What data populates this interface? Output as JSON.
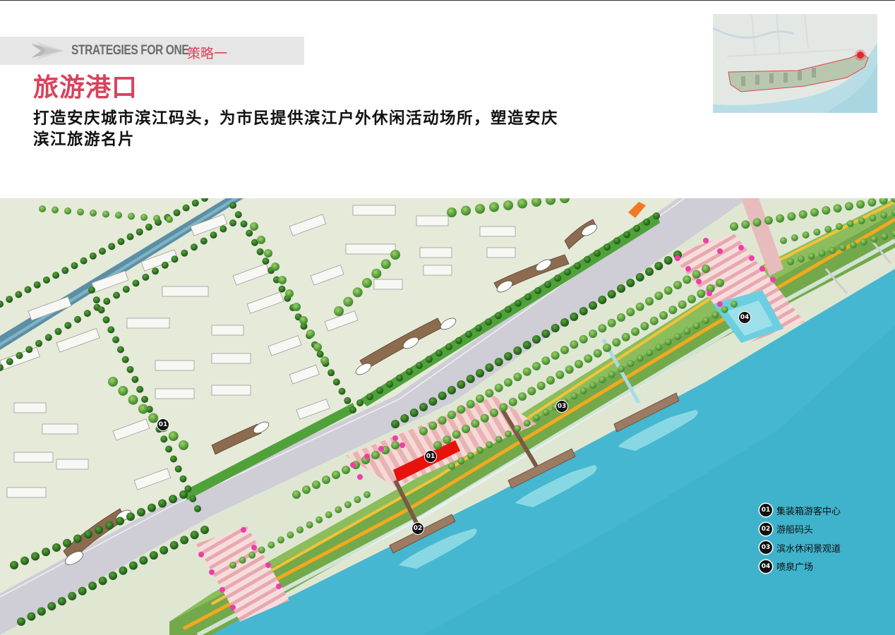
{
  "header": {
    "banner_en": "STRATEGIES FOR ONE",
    "banner_cn": "策略一",
    "title": "旅游港口",
    "description_line1": "打造安庆城市滨江码头，为市民提供滨江户外休闲活动场所，塑造安庆",
    "description_line2": "滨江旅游名片"
  },
  "map_markers": [
    "01",
    "02",
    "03",
    "04",
    "01"
  ],
  "legend": [
    {
      "num": "01",
      "label": "集装箱游客中心"
    },
    {
      "num": "02",
      "label": "游船码头"
    },
    {
      "num": "03",
      "label": "滨水休闲景观道"
    },
    {
      "num": "04",
      "label": "喷泉广场"
    }
  ],
  "colors": {
    "accent": "#d8435c",
    "water": "#3fb6cf",
    "park_green": "#6fa84a",
    "road": "#c8c8cf",
    "pink_paving": "#f2c7c7",
    "container": "#e8120c"
  }
}
